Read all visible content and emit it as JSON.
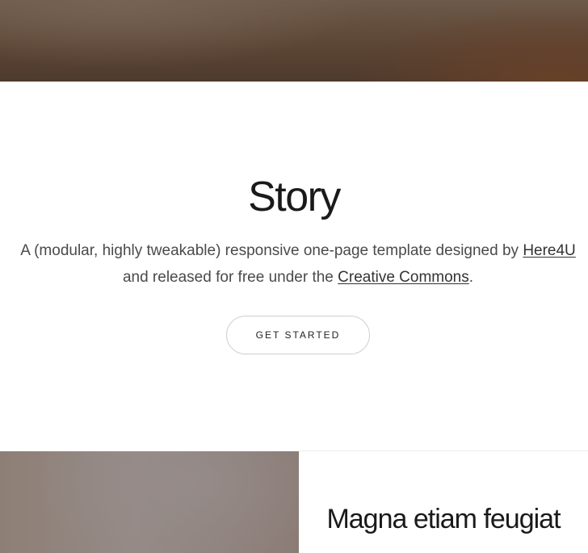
{
  "story": {
    "title": "Story",
    "description_before": "A (modular, highly tweakable) responsive one-page template designed by ",
    "link_author": "Here4U",
    "description_middle": " and released for free under the ",
    "link_license": "Creative Commons",
    "description_after": ".",
    "button_label": "GET STARTED"
  },
  "feature": {
    "title": "Magna etiam feugiat"
  }
}
